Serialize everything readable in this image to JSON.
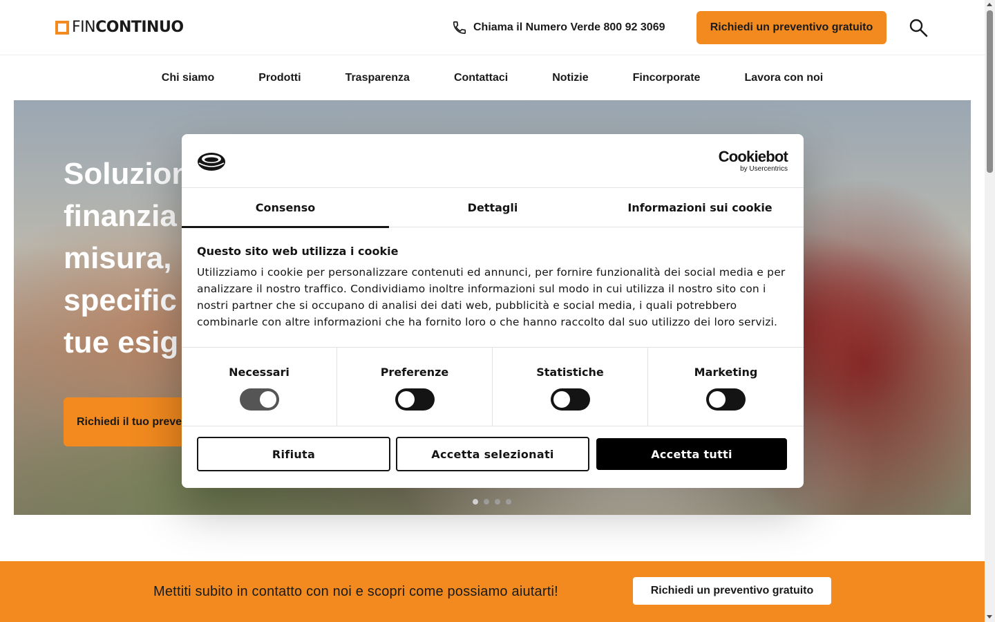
{
  "header": {
    "logo_light": "FIN",
    "logo_bold": "CONTINUO",
    "phone_text": "Chiama il Numero Verde 800 92 3069",
    "cta": "Richiedi un preventivo gratuito"
  },
  "nav": {
    "items": [
      "Chi siamo",
      "Prodotti",
      "Trasparenza",
      "Contattaci",
      "Notizie",
      "Fincorporate",
      "Lavora con noi"
    ]
  },
  "hero": {
    "title_lines": [
      "Soluzion",
      "finanzia",
      "misura,",
      "specific",
      "tue esig"
    ],
    "cta": "Richiedi il tuo preve",
    "slides_count": 4,
    "active_slide": 1
  },
  "band": {
    "text": "Mettiti subito in contatto con noi e scopri come possiamo aiutarti!",
    "button": "Richiedi un preventivo gratuito"
  },
  "cookie_dialog": {
    "brand_name": "Cookiebot",
    "brand_sub": "by Usercentrics",
    "tabs": [
      "Consenso",
      "Dettagli",
      "Informazioni sui cookie"
    ],
    "active_tab": "Consenso",
    "title": "Questo sito web utilizza i cookie",
    "body": "Utilizziamo i cookie per personalizzare contenuti ed annunci, per fornire funzionalità dei social media e per analizzare il nostro traffico. Condividiamo inoltre informazioni sul modo in cui utilizza il nostro sito con i nostri partner che si occupano di analisi dei dati web, pubblicità e social media, i quali potrebbero combinarle con altre informazioni che ha fornito loro o che hanno raccolto dal suo utilizzo dei loro servizi.",
    "categories": [
      {
        "label": "Necessari",
        "checked": true,
        "disabled": true
      },
      {
        "label": "Preferenze",
        "checked": false,
        "disabled": false
      },
      {
        "label": "Statistiche",
        "checked": false,
        "disabled": false
      },
      {
        "label": "Marketing",
        "checked": false,
        "disabled": false
      }
    ],
    "buttons": {
      "reject": "Rifiuta",
      "allow_selection": "Accetta selezionati",
      "allow_all": "Accetta tutti"
    }
  },
  "colors": {
    "brand_orange": "#f28a1f",
    "dark": "#141414"
  }
}
